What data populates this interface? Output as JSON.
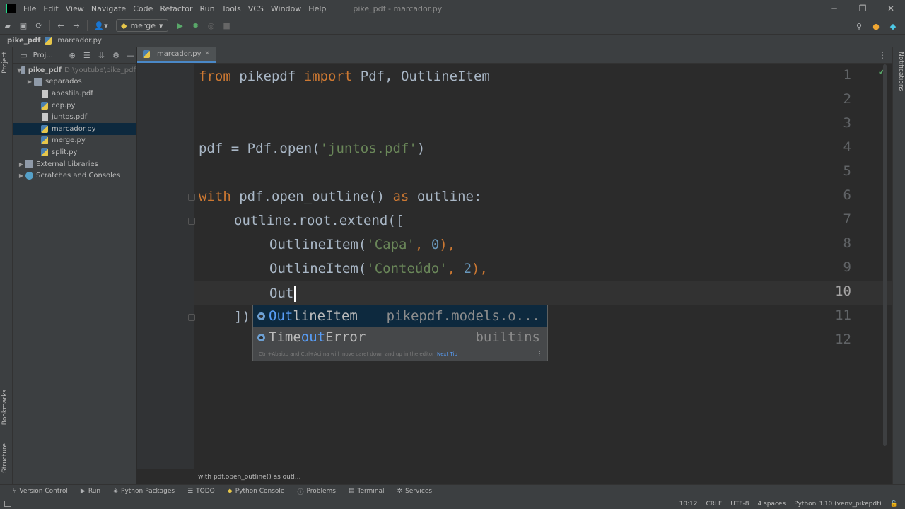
{
  "menubar": {
    "items": [
      "File",
      "Edit",
      "View",
      "Navigate",
      "Code",
      "Refactor",
      "Run",
      "Tools",
      "VCS",
      "Window",
      "Help"
    ],
    "window_title": "pike_pdf - marcador.py"
  },
  "toolbar": {
    "run_config": "merge"
  },
  "navbar": {
    "project": "pike_pdf",
    "file": "marcador.py"
  },
  "stripes": {
    "project": "Project",
    "bookmarks": "Bookmarks",
    "structure": "Structure",
    "notifications": "Notifications"
  },
  "project_panel": {
    "title": "Proj...",
    "root": {
      "name": "pike_pdf",
      "path": "D:\\youtube\\pike_pdf"
    },
    "items": [
      {
        "name": "separados",
        "type": "folder"
      },
      {
        "name": "apostila.pdf",
        "type": "pdf"
      },
      {
        "name": "cop.py",
        "type": "py"
      },
      {
        "name": "juntos.pdf",
        "type": "pdf"
      },
      {
        "name": "marcador.py",
        "type": "py"
      },
      {
        "name": "merge.py",
        "type": "py"
      },
      {
        "name": "split.py",
        "type": "py"
      }
    ],
    "external_libraries": "External Libraries",
    "scratches": "Scratches and Consoles"
  },
  "editor": {
    "tab": "marcador.py",
    "line_numbers": [
      "1",
      "2",
      "3",
      "4",
      "5",
      "6",
      "7",
      "8",
      "9",
      "10",
      "11",
      "12"
    ],
    "code": {
      "l1_from": "from",
      "l1_module": " pikepdf ",
      "l1_import": "import",
      "l1_names": " Pdf, OutlineItem",
      "l4_a": "pdf = Pdf.open(",
      "l4_str": "'juntos.pdf'",
      "l4_b": ")",
      "l6_with": "with",
      "l6_mid": " pdf.open_outline() ",
      "l6_as": "as",
      "l6_end": " outline:",
      "l7": "outline.root.extend([",
      "l8_a": "OutlineItem(",
      "l8_str": "'Capa'",
      "l8_comma": ", ",
      "l8_num": "0",
      "l8_b": "),",
      "l9_a": "OutlineItem(",
      "l9_str": "'Conteúdo'",
      "l9_comma": ", ",
      "l9_num": "2",
      "l9_b": "),",
      "l10": "Out",
      "l11": "])"
    }
  },
  "completion": {
    "items": [
      {
        "pre": "",
        "match": "Out",
        "post": "lineItem",
        "type": "pikepdf.models.o..."
      },
      {
        "pre": "Time",
        "match": "out",
        "post": "Error",
        "type": "builtins"
      }
    ],
    "hint": "Ctrl+Abaixo and Ctrl+Acima will move caret down and up in the editor",
    "hint_link": "Next Tip"
  },
  "editor_breadcrumb": "with pdf.open_outline() as outl...",
  "tool_windows": [
    "Version Control",
    "Run",
    "Python Packages",
    "TODO",
    "Python Console",
    "Problems",
    "Terminal",
    "Services"
  ],
  "status": {
    "position": "10:12",
    "line_sep": "CRLF",
    "encoding": "UTF-8",
    "indent": "4 spaces",
    "interpreter": "Python 3.10 (venv_pikepdf)"
  },
  "colors": {
    "keyword": "#cc7832",
    "string": "#6a8759",
    "number": "#6897bb",
    "selection": "#0d293e"
  }
}
